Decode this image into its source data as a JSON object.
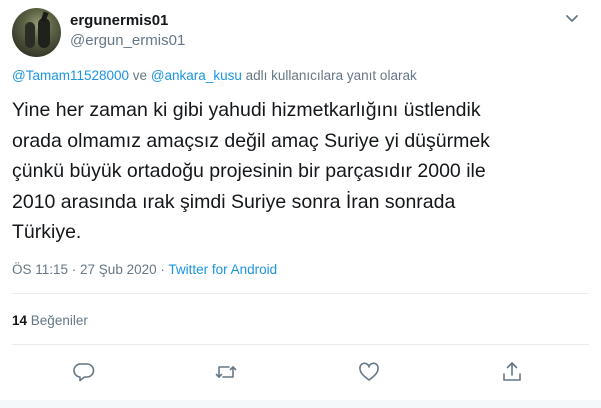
{
  "tweet": {
    "display_name": "ergunermis01",
    "handle": "@ergun_ermis01",
    "reply_to": {
      "users": [
        "@Tamam11528000",
        "@ankara_kusu"
      ],
      "connector": "ve",
      "suffix": "adlı kullanıcılara yanıt olarak"
    },
    "text_lines": [
      "Yine her zaman ki gibi yahudi hizmetkarlığını üstlendik",
      "orada olmamız amaçsız değil amaç Suriye yi düşürmek",
      "çünkü büyük ortadoğu projesinin bir parçasıdır 2000 ile",
      "2010 arasında ırak şimdi Suriye sonra İran sonrada",
      "Türkiye."
    ],
    "timestamp": "ÖS 11:15 · 27 Şub 2020",
    "separator": " · ",
    "source": "Twitter for Android",
    "likes_count": "14",
    "likes_label": "Beğeniler"
  },
  "icons": {
    "more": "chevron-down-icon",
    "reply": "reply-icon",
    "retweet": "retweet-icon",
    "like": "heart-icon",
    "share": "share-icon"
  },
  "colors": {
    "link": "#1b95e0",
    "secondary_text": "#657786",
    "primary_text": "#14171a",
    "divider": "#e6ecf0"
  }
}
